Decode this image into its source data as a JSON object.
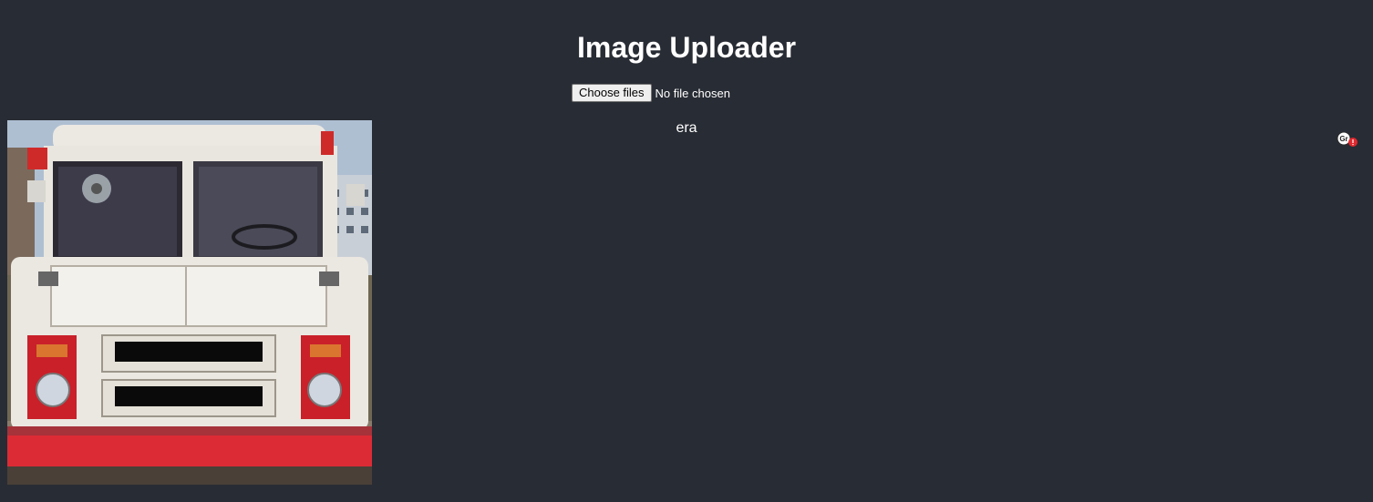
{
  "page": {
    "title": "Image Uploader"
  },
  "uploader": {
    "button_label": "Choose files",
    "status": "No file chosen"
  },
  "results": {
    "image_icon": "ice-cream-truck-photo",
    "caption": "era"
  },
  "extension": {
    "badge_text": "Gr",
    "icon": "grammarly-extension-icon",
    "alert_color": "#e0282e"
  },
  "colors": {
    "background": "#282c34",
    "text": "#ffffff"
  }
}
